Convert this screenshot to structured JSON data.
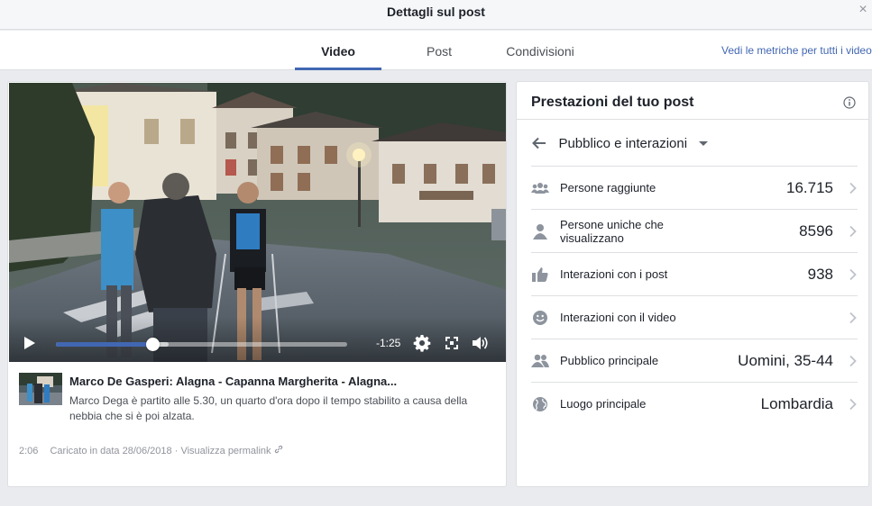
{
  "dialog": {
    "title": "Dettagli sul post",
    "close_glyph": "×"
  },
  "tabs": [
    {
      "label": "Video",
      "active": true
    },
    {
      "label": "Post",
      "active": false
    },
    {
      "label": "Condivisioni",
      "active": false
    }
  ],
  "metrics_link": "Vedi le metriche per tutti i video",
  "player": {
    "remaining_time": "-1:25",
    "progress_fraction": 0.33,
    "accent_color": "#4267b2",
    "icons": [
      "play-icon",
      "gear-icon",
      "fullscreen-icon",
      "volume-icon"
    ]
  },
  "video": {
    "title": "Marco De Gasperi: Alagna - Capanna Margherita - Alagna...",
    "description": "Marco Dega è partito alle 5.30, un quarto d'ora dopo il tempo stabilito a causa della nebbia che si è poi alzata.",
    "duration": "2:06",
    "uploaded": "Caricato in data 28/06/2018",
    "separator": "·",
    "permalink": "Visualizza permalink"
  },
  "performance": {
    "title": "Prestazioni del tuo post",
    "selector_label": "Pubblico e interazioni",
    "rows": [
      {
        "icon": "people-group-icon",
        "label": "Persone raggiunte",
        "value": "16.715"
      },
      {
        "icon": "person-icon",
        "label": "Persone uniche che visualizzano",
        "value": "8596"
      },
      {
        "icon": "thumbs-up-icon",
        "label": "Interazioni con i post",
        "value": "938"
      },
      {
        "icon": "smiley-icon",
        "label": "Interazioni con il video",
        "value": ""
      },
      {
        "icon": "people-pair-icon",
        "label": "Pubblico principale",
        "value": "Uomini, 35-44"
      },
      {
        "icon": "globe-icon",
        "label": "Luogo principale",
        "value": "Lombardia"
      }
    ]
  }
}
